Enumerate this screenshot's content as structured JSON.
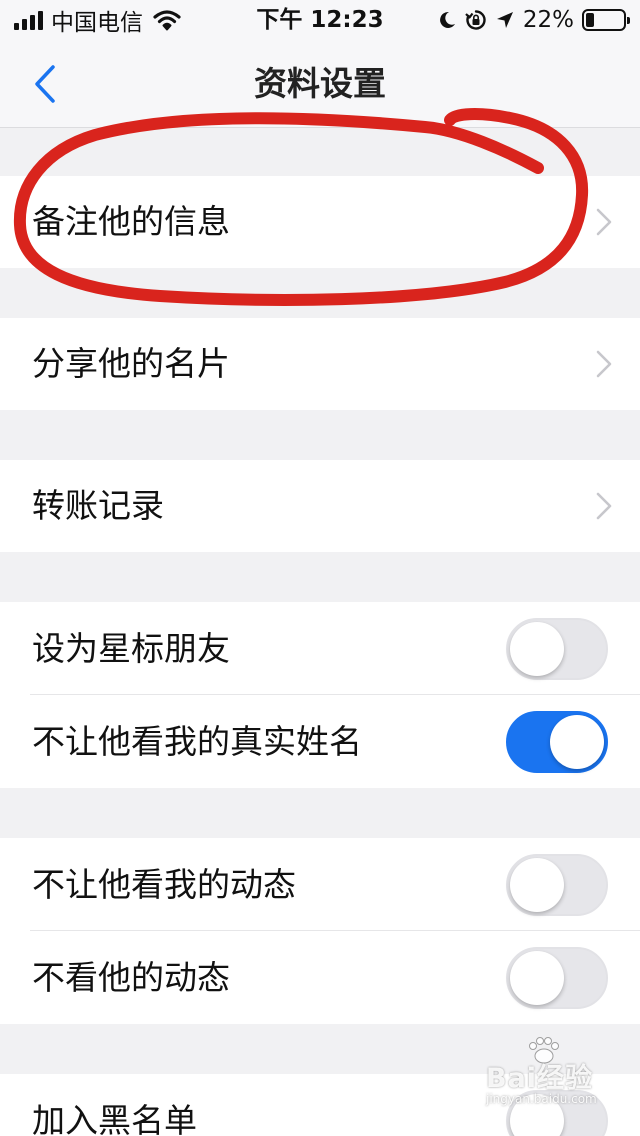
{
  "status_bar": {
    "carrier": "中国电信",
    "time": "下午 12:23",
    "battery": "22%",
    "battery_level": 0.22,
    "icons": [
      "signal-icon",
      "wifi-icon",
      "moon-icon",
      "orientation-lock-icon",
      "location-icon",
      "battery-icon"
    ]
  },
  "nav": {
    "title": "资料设置",
    "back_icon": "chevron-left-icon"
  },
  "settings": {
    "remark_info": "备注他的信息",
    "share_card": "分享他的名片",
    "transfer_records": "转账记录",
    "star_friend": {
      "label": "设为星标朋友",
      "on": false
    },
    "hide_real_name": {
      "label": "不让他看我的真实姓名",
      "on": true
    },
    "hide_my_moments": {
      "label": "不让他看我的动态",
      "on": false
    },
    "hide_his_moments": {
      "label": "不看他的动态",
      "on": false
    },
    "blacklist": {
      "label": "加入黑名单",
      "on": false
    }
  },
  "annotation": {
    "color": "#d9241d"
  },
  "watermark": {
    "text": "Bai经验",
    "sub": "jingyan.baidu.com"
  },
  "colors": {
    "accent": "#1a74f0",
    "background": "#f1f1f3"
  }
}
